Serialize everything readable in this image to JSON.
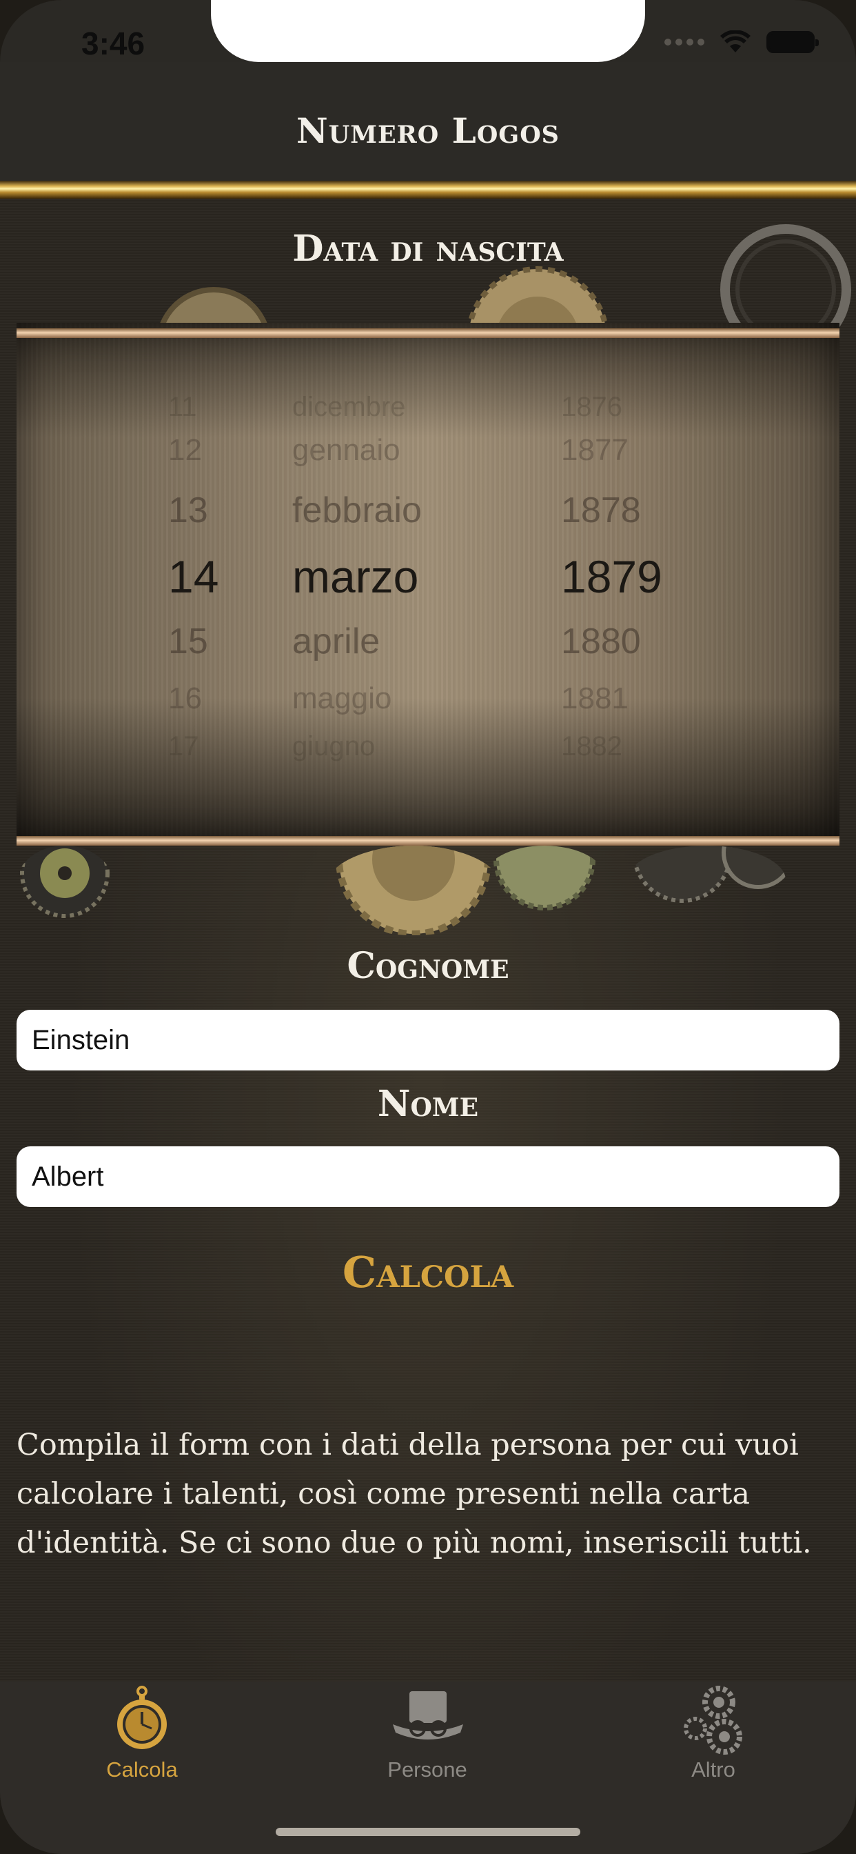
{
  "status_bar": {
    "time": "3:46"
  },
  "nav": {
    "title": "Numero Logos"
  },
  "date_section": {
    "title": "Data di nascita",
    "days": [
      "11",
      "12",
      "13",
      "14",
      "15",
      "16",
      "17"
    ],
    "months": [
      "dicembre",
      "gennaio",
      "febbraio",
      "marzo",
      "aprile",
      "maggio",
      "giugno"
    ],
    "years": [
      "1876",
      "1877",
      "1878",
      "1879",
      "1880",
      "1881",
      "1882"
    ],
    "selected": {
      "day": "14",
      "month": "marzo",
      "year": "1879"
    }
  },
  "surname": {
    "label": "Cognome",
    "value": "Einstein"
  },
  "name": {
    "label": "Nome",
    "value": "Albert"
  },
  "action": {
    "label": "Calcola"
  },
  "help": {
    "text": "Compila il form con i dati della persona per cui vuoi calcolare i talenti, così come presenti nella carta d'identità. Se ci sono due o più nomi, inseriscili tutti."
  },
  "tabs": [
    {
      "label": "Calcola",
      "icon": "pocket-watch-icon",
      "active": true
    },
    {
      "label": "Persone",
      "icon": "top-hat-goggles-icon",
      "active": false
    },
    {
      "label": "Altro",
      "icon": "gears-icon",
      "active": false
    }
  ],
  "colors": {
    "accent": "#d6a43f",
    "inactive_tab": "#8d8a85",
    "nav_background": "#2c2a26",
    "text_light": "#f3efe6"
  }
}
